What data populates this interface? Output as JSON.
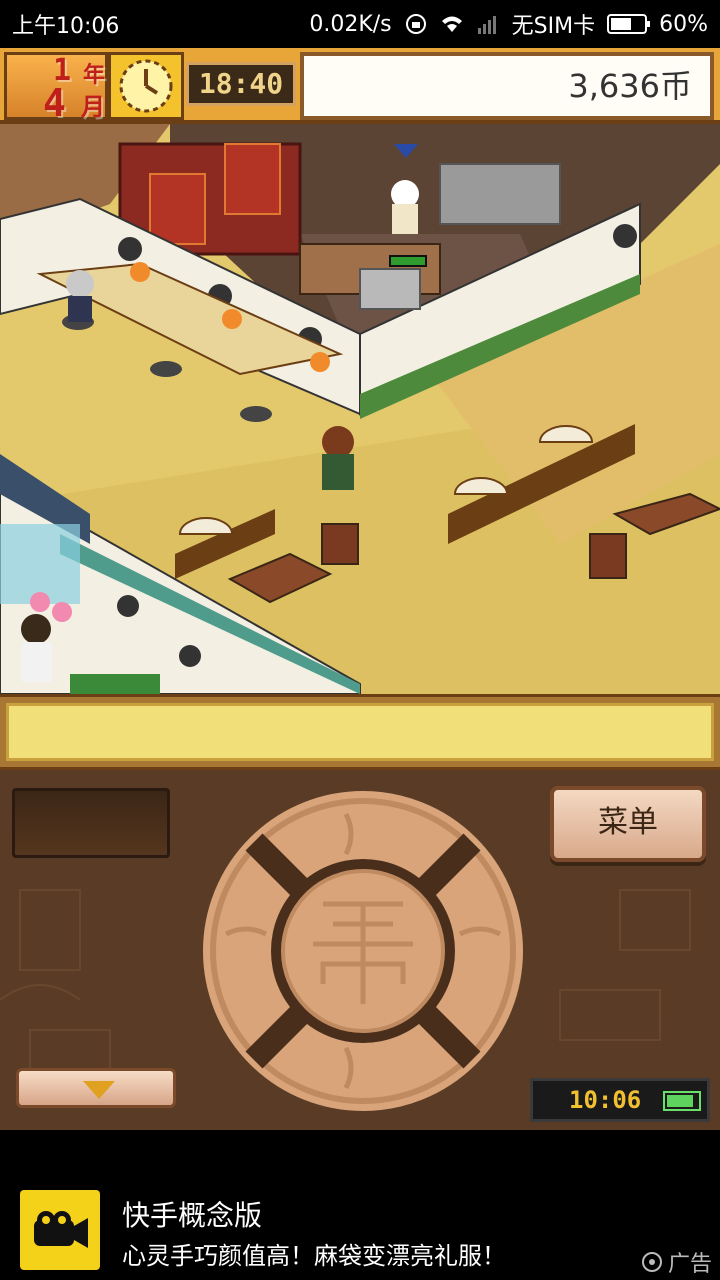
{
  "status_bar": {
    "time": "上午10:06",
    "network_speed": "0.02K/s",
    "carrier": "无SIM卡",
    "battery_percent": "60%"
  },
  "hud": {
    "year_num": "1",
    "year_unit": "年",
    "month_num": "4",
    "month_unit": "月",
    "game_time": "18:40",
    "coins": "3,636币"
  },
  "controls": {
    "menu_label": "菜单",
    "clock_time": "10:06"
  },
  "ad": {
    "title": "快手概念版",
    "subtitle": "心灵手巧颜值高！麻袋变漂亮礼服！",
    "tag": "广告"
  },
  "colors": {
    "hud_orange": "#e9a638",
    "controls_brown": "#5a3c26",
    "dpad_wood": "#d9a47a",
    "message_yellow": "#f1e07a",
    "ad_logo_yellow": "#f5d21a"
  }
}
